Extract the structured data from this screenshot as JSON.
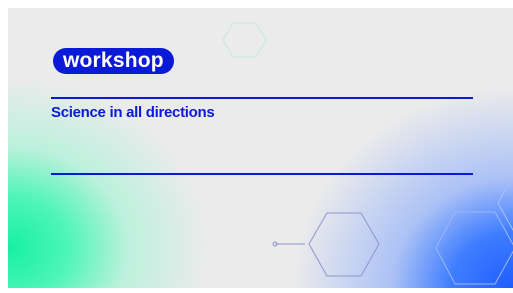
{
  "slide": {
    "badge_text": "workshop",
    "subtitle": "Science in all directions"
  },
  "colors": {
    "accent_blue": "#0a1ad6",
    "gradient_green": "#15f0a2",
    "gradient_blue": "#1f5cff",
    "background_gray": "#ebebeb"
  }
}
